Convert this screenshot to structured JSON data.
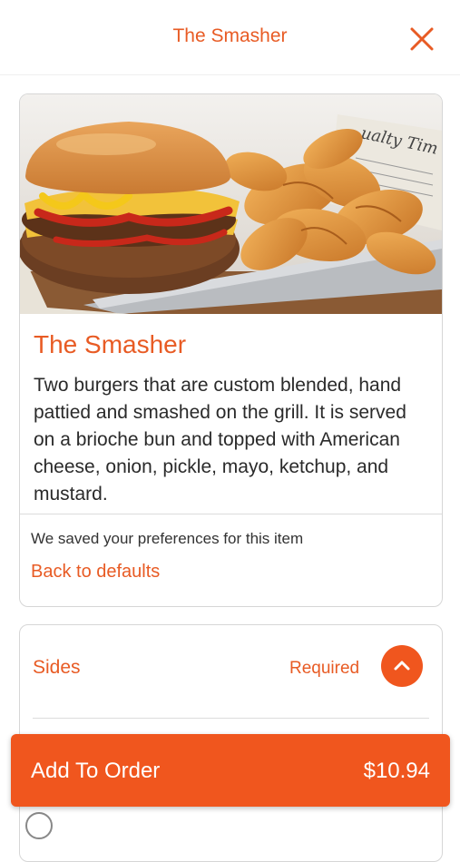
{
  "header": {
    "title": "The Smasher",
    "close_icon": "close-icon"
  },
  "item": {
    "image": "burger-and-chips-photo",
    "newspaper_text": "ualty Tim",
    "title": "The Smasher",
    "description": "Two burgers that are custom blended, hand pattied and smashed on the grill. It is served on a brioche bun and topped with American cheese, onion, pickle, mayo, ketchup, and mustard.",
    "preferences_note": "We saved your preferences for this item",
    "back_to_defaults": "Back to defaults"
  },
  "sides": {
    "title": "Sides",
    "required_label": "Required",
    "toggle_icon": "chevron-up-icon"
  },
  "order_bar": {
    "label": "Add To Order",
    "price": "$10.94"
  },
  "colors": {
    "accent": "#f0561e",
    "accent_text": "#e85b24",
    "border": "#d6d6d6",
    "background": "#ffffff"
  }
}
